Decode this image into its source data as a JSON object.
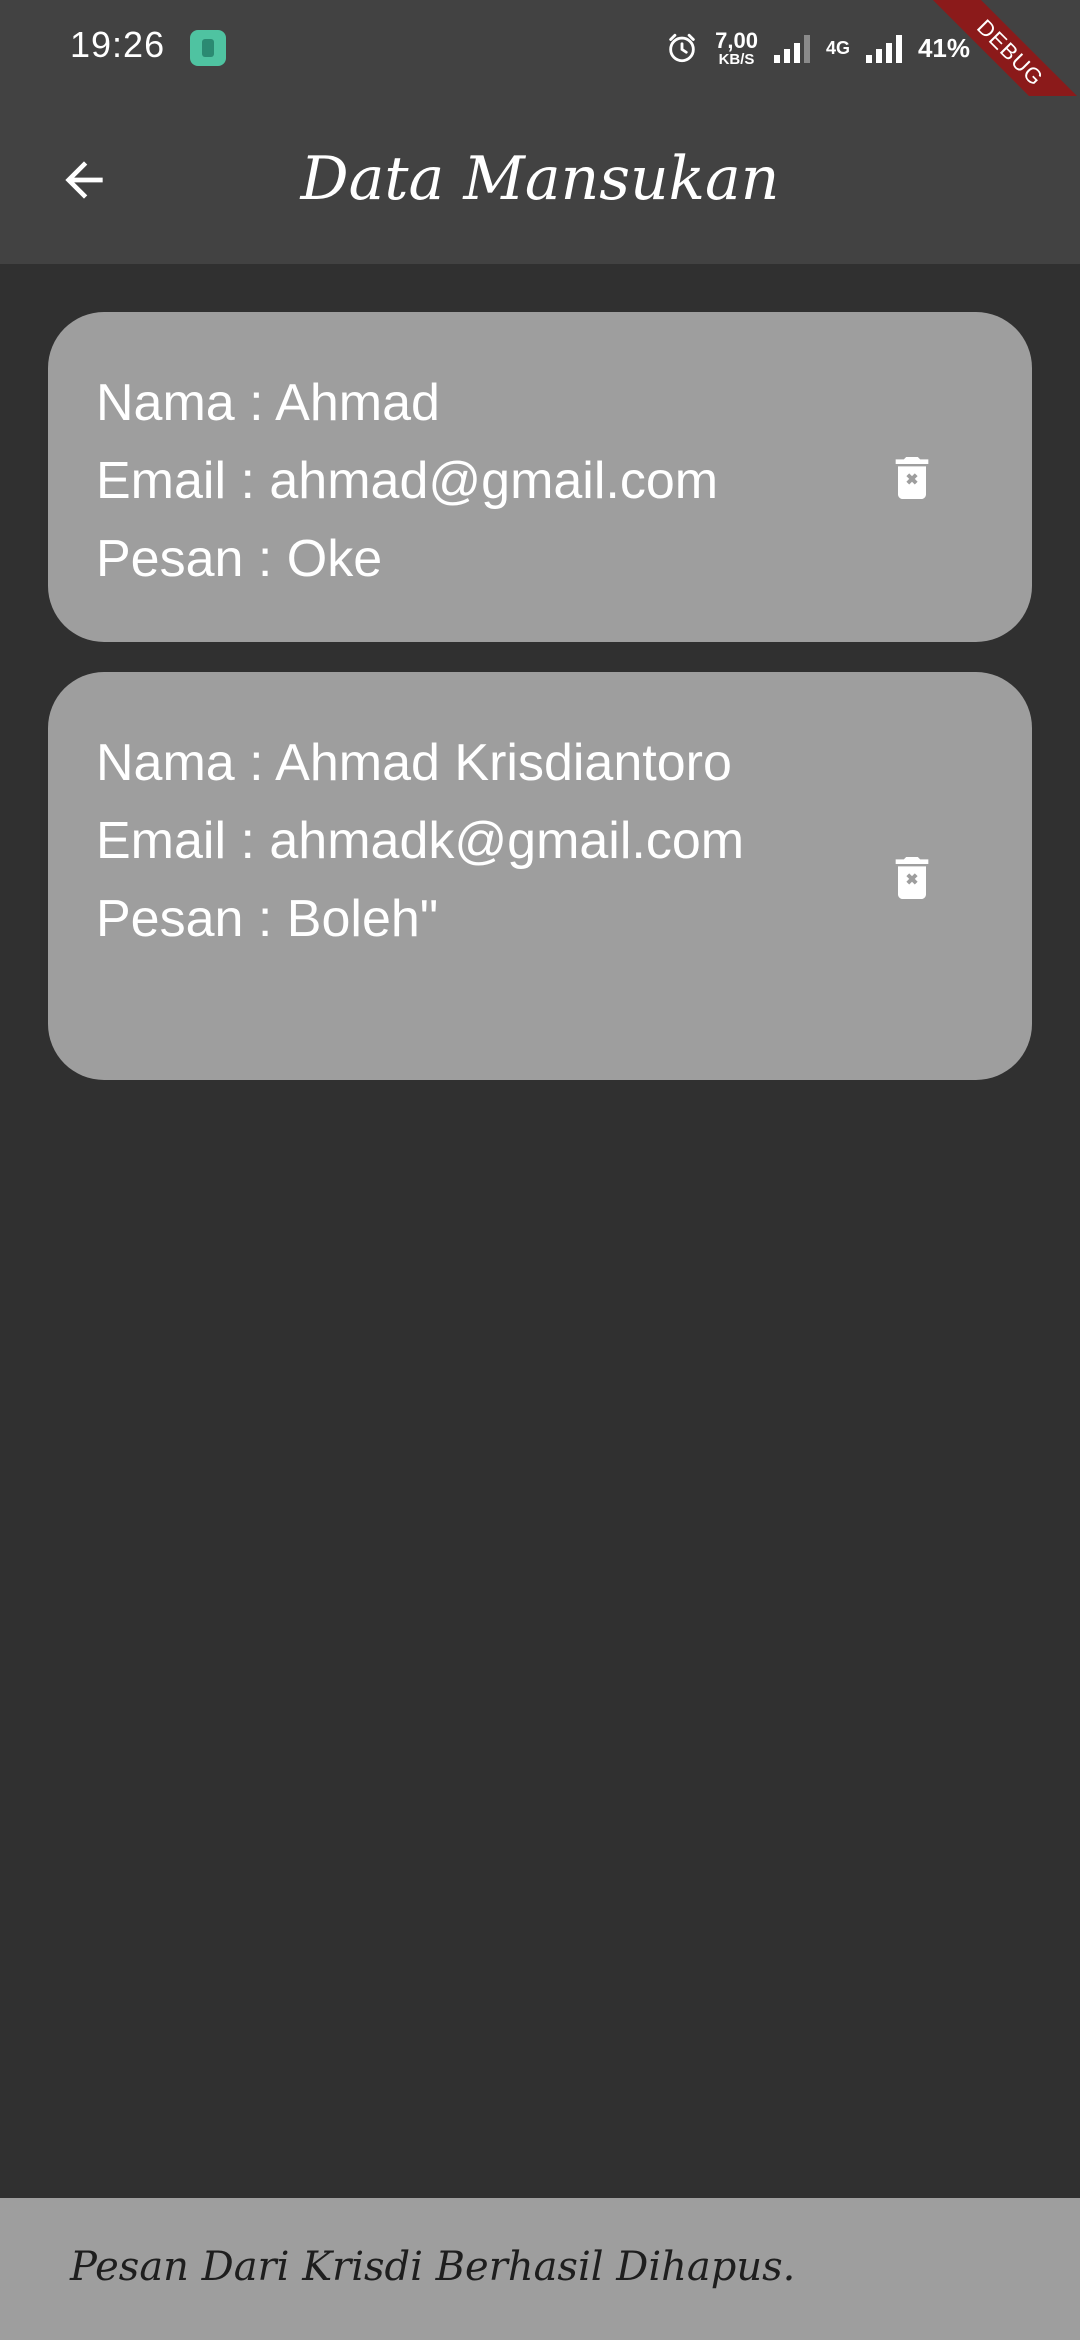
{
  "status_bar": {
    "time": "19:26",
    "net_speed_value": "7,00",
    "net_speed_unit": "KB/S",
    "net_type": "4G",
    "battery": "41%"
  },
  "debug_banner": "DEBUG",
  "app_bar": {
    "title": "Data Mansukan",
    "back_icon": "arrow-back-icon"
  },
  "messages": [
    {
      "nama": "Nama : Ahmad",
      "email": "Email : ahmad@gmail.com",
      "pesan": "Pesan : Oke",
      "delete_icon": "delete-forever-icon"
    },
    {
      "nama": "Nama : Ahmad Krisdiantoro",
      "email": "Email : ahmadk@gmail.com",
      "pesan": "Pesan : Boleh\"",
      "delete_icon": "delete-forever-icon"
    }
  ],
  "snackbar": {
    "text": "Pesan Dari Krisdi Berhasil Dihapus."
  },
  "colors": {
    "background": "#303030",
    "app_bar": "#424242",
    "card": "#9e9e9e",
    "debug_ribbon": "#8b1a1a",
    "snackbar": "#9e9e9e"
  }
}
